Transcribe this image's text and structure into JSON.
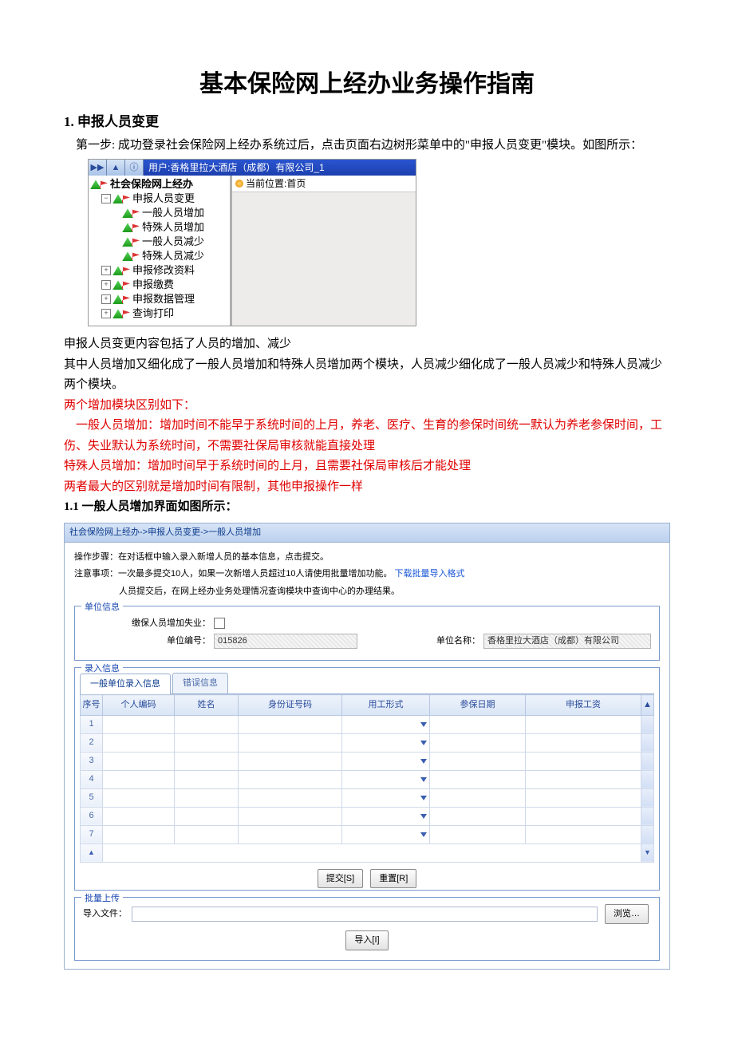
{
  "title": "基本保险网上经办业务操作指南",
  "section1": {
    "heading": "1. 申报人员变更",
    "p1": "第一步: 成功登录社会保险网上经办系统过后，点击页面右边树形菜单中的\"申报人员变更\"模块。如图所示：",
    "p2": "申报人员变更内容包括了人员的增加、减少",
    "p3": "其中人员增加又细化成了一般人员增加和特殊人员增加两个模块，人员减少细化成了一般人员减少和特殊人员减少两个模块。",
    "r1": "两个增加模块区别如下：",
    "r2": "一般人员增加：增加时间不能早于系统时间的上月，养老、医疗、生育的参保时间统一默认为养老参保时间，工伤、失业默认为系统时间，不需要社保局审核就能直接处理",
    "r3": "特殊人员增加：增加时间早于系统时间的上月，且需要社保局审核后才能处理",
    "r4": "两者最大的区别就是增加时间有限制，其他申报操作一样",
    "sub11": "1.1 一般人员增加界面如图所示："
  },
  "tree_shot": {
    "user_bar": "用户:香格里拉大酒店（成都）有限公司_1",
    "location_label": "当前位置:首页",
    "root": "社会保险网上经办",
    "n1": "申报人员变更",
    "n1_children": [
      "一般人员增加",
      "特殊人员增加",
      "一般人员减少",
      "特殊人员减少"
    ],
    "n2": "申报修改资料",
    "n3": "申报缴费",
    "n4": "申报数据管理",
    "n5": "查询打印"
  },
  "form_shot": {
    "breadcrumb": "社会保险网上经办->申报人员变更->一般人员增加",
    "intro1": "操作步骤：在对话框中输入录入新增人员的基本信息，点击提交。",
    "intro2_a": "注意事项：一次最多提交10人，如果一次新增人员超过10人请使用批量增加功能。",
    "intro2_link": "下载批量导入格式",
    "intro3": "人员提交后，在网上经办业务处理情况查询模块中查询中心的办理结果。",
    "fs_unit": "单位信息",
    "unit_chk_label": "缴保人员增加失业：",
    "unit_code_label": "单位编号：",
    "unit_code_value": "015826",
    "unit_name_label": "单位名称：",
    "unit_name_value": "香格里拉大酒店（成都）有限公司",
    "fs_input": "录入信息",
    "tab_active": "一般单位录入信息",
    "tab_inactive": "错误信息",
    "columns": [
      "序号",
      "个人编码",
      "姓名",
      "身份证号码",
      "用工形式",
      "参保日期",
      "申报工资"
    ],
    "row_count": 7,
    "btn_submit": "提交[S]",
    "btn_reset": "重置[R]",
    "fs_batch": "批量上传",
    "file_label": "导入文件：",
    "btn_browse": "浏览…",
    "btn_import": "导入[I]"
  }
}
